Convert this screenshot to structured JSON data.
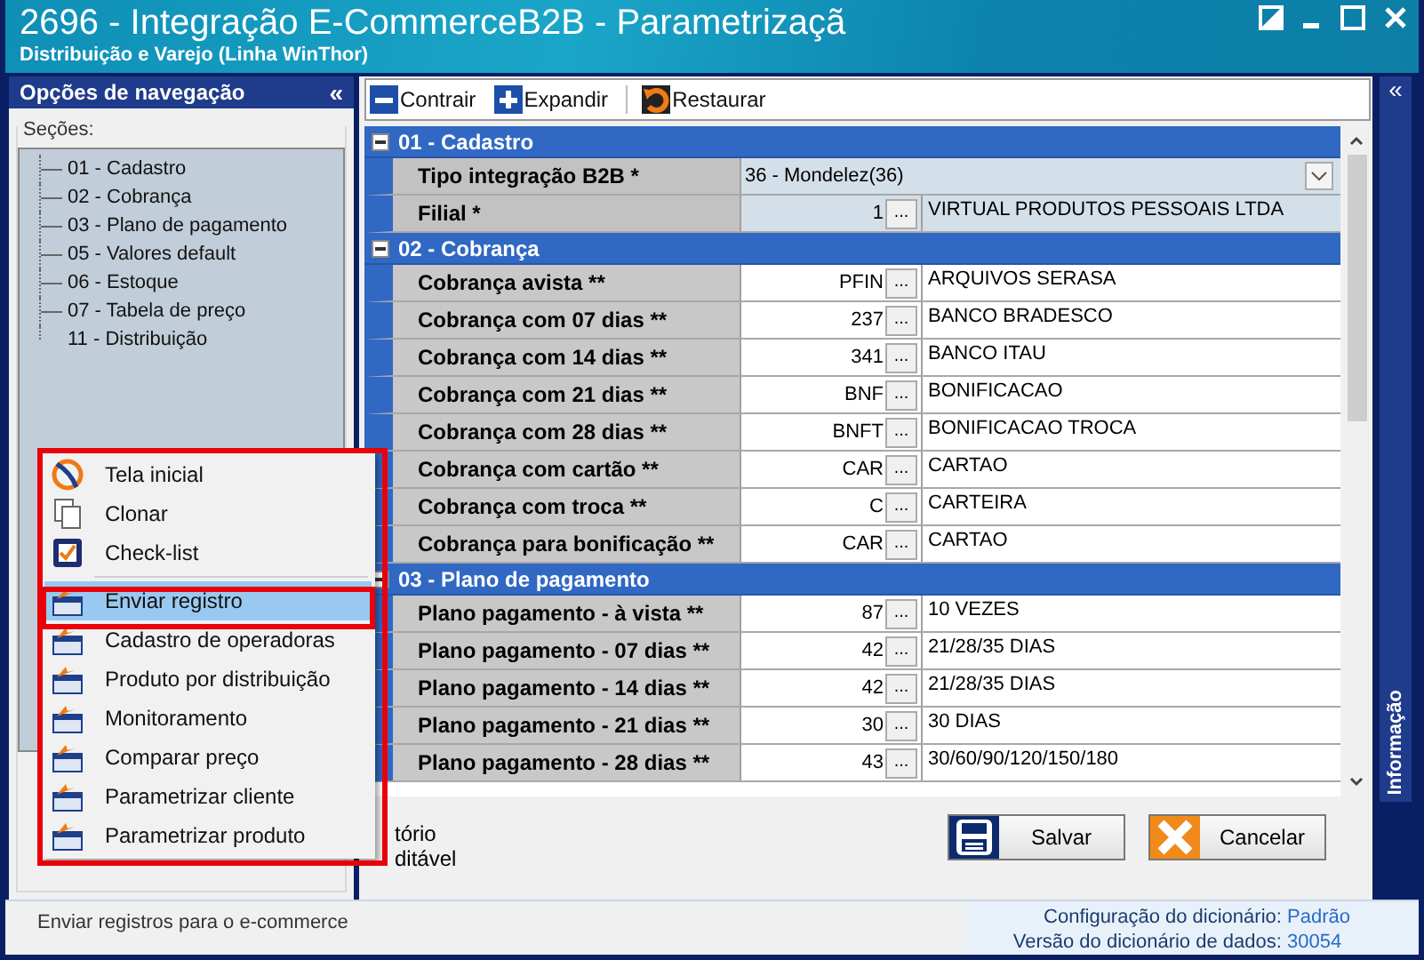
{
  "window": {
    "title": "2696 - Integração E-CommerceB2B - Parametrizaçã",
    "subtitle": "Distribuição e Varejo (Linha WinThor)"
  },
  "nav_panel": {
    "title": "Opções de navegação",
    "collapse": "«",
    "sections_label": "Seções:",
    "items": [
      {
        "label": "01 - Cadastro"
      },
      {
        "label": "02 - Cobrança"
      },
      {
        "label": "03 - Plano de pagamento"
      },
      {
        "label": "05 - Valores default"
      },
      {
        "label": "06 - Estoque"
      },
      {
        "label": "07 - Tabela de preço"
      },
      {
        "label": "11 - Distribuição"
      }
    ]
  },
  "toolbar": [
    {
      "label": "Contrair",
      "kind": "minus"
    },
    {
      "label": "Expandir",
      "kind": "plus"
    },
    {
      "label": "Restaurar",
      "kind": "restore"
    }
  ],
  "panel_collapse": "«",
  "groups": [
    {
      "title": "01 - Cadastro",
      "expanded": true,
      "rows": [
        {
          "kind": "dropdown",
          "label": "Tipo integração B2B *",
          "value": "36 - Mondelez(36)",
          "selected": true
        },
        {
          "kind": "lookup",
          "label": "Filial *",
          "code": "1",
          "description": "VIRTUAL PRODUTOS PESSOAIS LTDA",
          "selected": true
        }
      ]
    },
    {
      "title": "02 - Cobrança",
      "expanded": true,
      "rows": [
        {
          "kind": "lookup",
          "label": "Cobrança  avista **",
          "code": "PFIN",
          "description": "ARQUIVOS SERASA",
          "selected": false
        },
        {
          "kind": "lookup",
          "label": "Cobrança  com 07 dias **",
          "code": "237",
          "description": "BANCO BRADESCO",
          "selected": false
        },
        {
          "kind": "lookup",
          "label": "Cobrança  com 14 dias **",
          "code": "341",
          "description": "BANCO ITAU",
          "selected": false
        },
        {
          "kind": "lookup",
          "label": "Cobrança  com 21 dias **",
          "code": "BNF",
          "description": "BONIFICACAO",
          "selected": false
        },
        {
          "kind": "lookup",
          "label": "Cobrança  com 28 dias **",
          "code": "BNFT",
          "description": "BONIFICACAO TROCA",
          "selected": false
        },
        {
          "kind": "lookup",
          "label": "Cobrança  com cartão **",
          "code": "CAR",
          "description": "CARTAO",
          "selected": false
        },
        {
          "kind": "lookup",
          "label": "Cobrança  com troca **",
          "code": "C",
          "description": "CARTEIRA",
          "selected": false
        },
        {
          "kind": "lookup",
          "label": "Cobrança para bonificação **",
          "code": "CAR",
          "description": "CARTAO",
          "selected": false
        }
      ]
    },
    {
      "title": "03 - Plano de pagamento",
      "expanded": true,
      "rows": [
        {
          "kind": "lookup",
          "label": "Plano pagamento - à vista **",
          "code": "87",
          "description": "10 VEZES",
          "selected": false
        },
        {
          "kind": "lookup",
          "label": "Plano pagamento - 07 dias **",
          "code": "42",
          "description": "21/28/35 DIAS",
          "selected": false
        },
        {
          "kind": "lookup",
          "label": "Plano pagamento - 14 dias **",
          "code": "42",
          "description": "21/28/35 DIAS",
          "selected": false
        },
        {
          "kind": "lookup",
          "label": "Plano pagamento - 21 dias **",
          "code": "30",
          "description": "30 DIAS",
          "selected": false
        },
        {
          "kind": "lookup",
          "label": "Plano pagamento - 28 dias **",
          "code": "43",
          "description": "30/60/90/120/150/180",
          "selected": false
        }
      ]
    }
  ],
  "lookup_button": "...",
  "legend": [
    "tório",
    "ditável"
  ],
  "buttons": [
    {
      "label": "Salvar",
      "kind": "save"
    },
    {
      "label": "Cancelar",
      "kind": "cancel"
    }
  ],
  "info_tab": "Informação",
  "context_menu": [
    {
      "label": "Tela inicial",
      "kind": "logo",
      "selected": false
    },
    {
      "label": "Clonar",
      "kind": "pages",
      "selected": false
    },
    {
      "label": "Check-list",
      "kind": "checklist",
      "selected": false
    },
    {
      "label": "Enviar registro",
      "kind": "window",
      "selected": true
    },
    {
      "label": "Cadastro de operadoras",
      "kind": "window",
      "selected": false
    },
    {
      "label": "Produto por distribuição",
      "kind": "window",
      "selected": false
    },
    {
      "label": "Monitoramento",
      "kind": "window",
      "selected": false
    },
    {
      "label": "Comparar preço",
      "kind": "window",
      "selected": false
    },
    {
      "label": "Parametrizar cliente",
      "kind": "window",
      "selected": false
    },
    {
      "label": "Parametrizar produto",
      "kind": "window",
      "selected": false
    }
  ],
  "status_bar": {
    "message": "Enviar registros para o e-commerce",
    "config_label": "Configuração do dicionário:",
    "config_value": "Padrão",
    "version_label": "Versão do dicionário de dados:",
    "version_value": "30054"
  }
}
